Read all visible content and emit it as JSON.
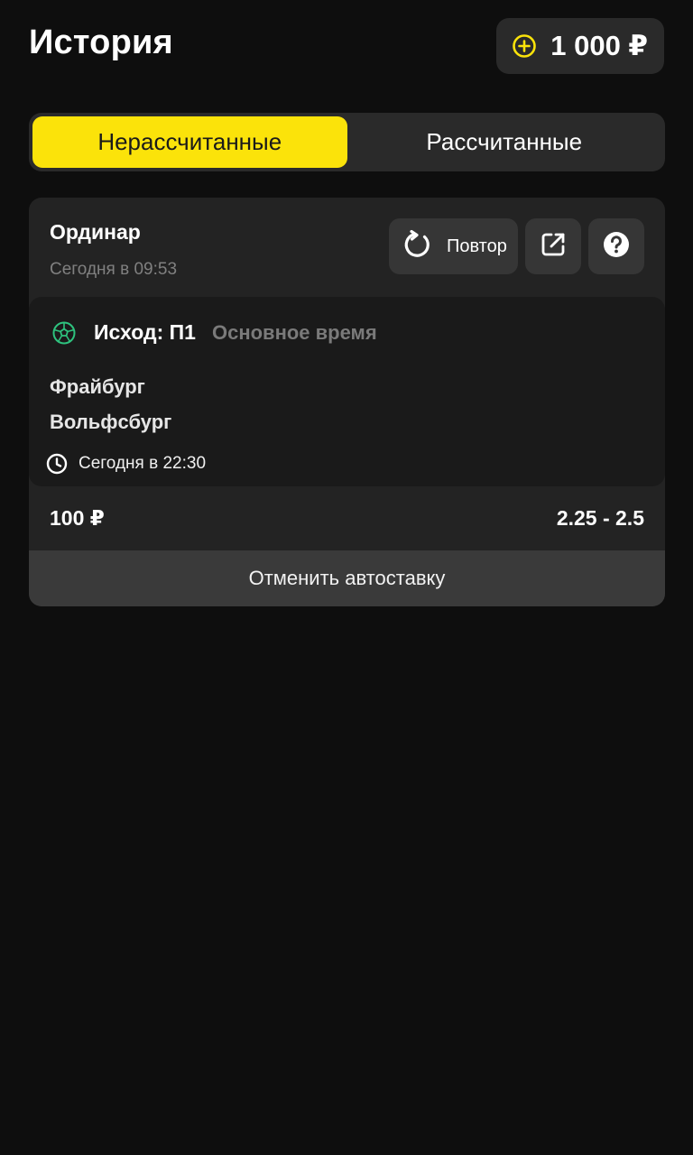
{
  "header": {
    "title": "История",
    "balance": "1 000 ₽",
    "balance_icon": "plus-circle-icon"
  },
  "tabs": [
    {
      "label": "Нерассчитанные",
      "active": true
    },
    {
      "label": "Рассчитанные",
      "active": false
    }
  ],
  "bet": {
    "type": "Ординар",
    "date": "Сегодня в 09:53",
    "repeat_label": "Повтор",
    "share_icon": "share-icon",
    "help_icon": "help-icon",
    "event": {
      "sport_icon": "football-icon",
      "outcome": "Исход: П1",
      "period": "Основное время",
      "team1": "Фрайбург",
      "team2": "Вольфсбург",
      "time": "Сегодня в 22:30"
    },
    "stake": "100 ₽",
    "odds": "2.25 - 2.5",
    "cancel_label": "Отменить автоставку"
  },
  "colors": {
    "background": "#0e0e0e",
    "accent": "#fbe30a",
    "card": "#232323",
    "sport_icon": "#2ec27e"
  }
}
